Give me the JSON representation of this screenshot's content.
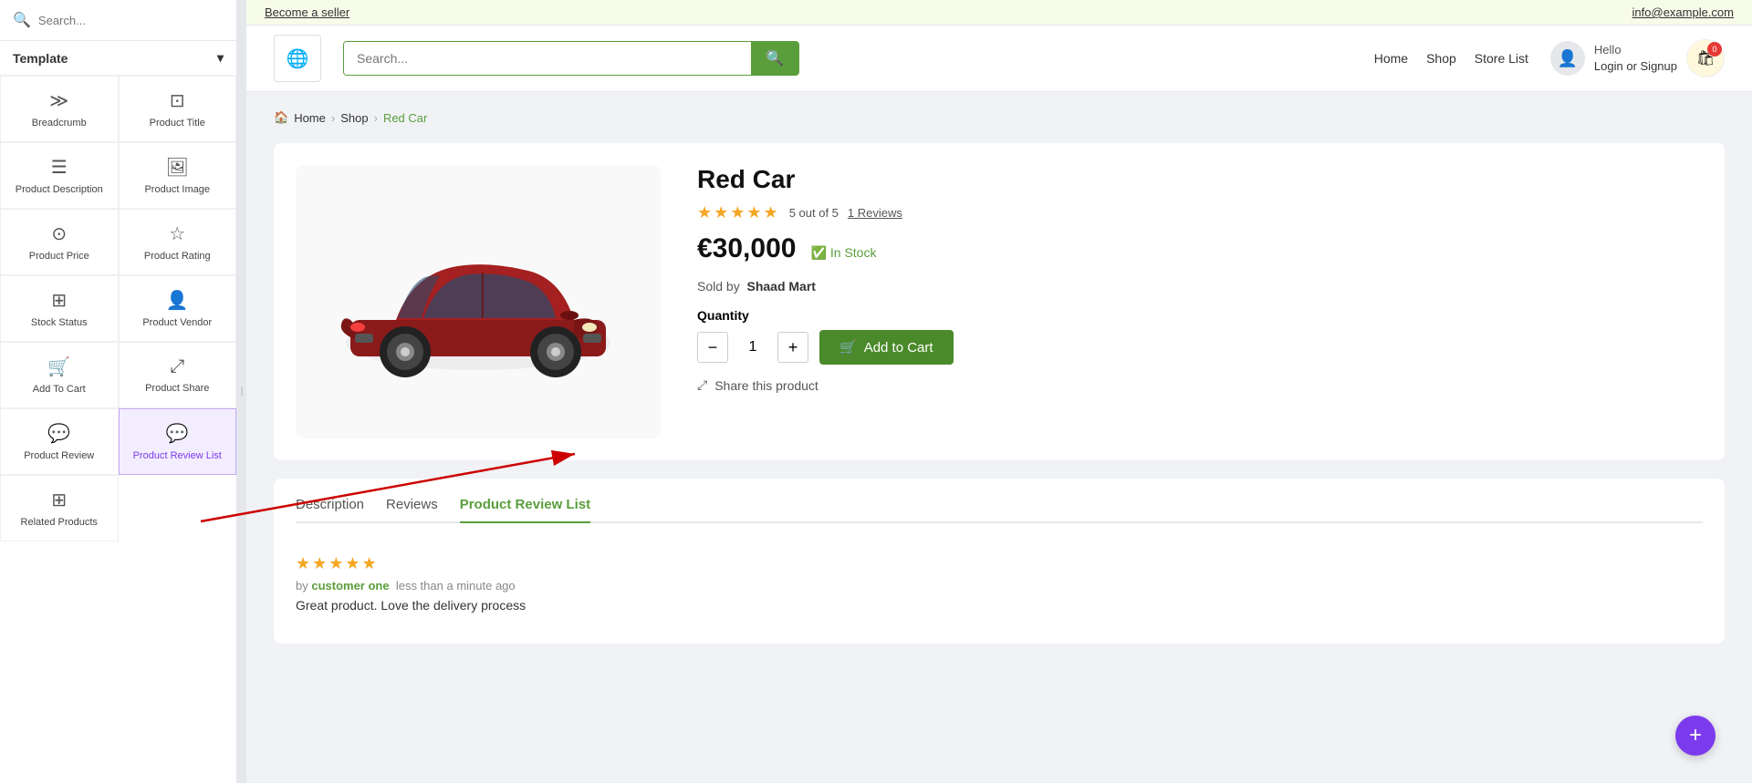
{
  "topbar": {
    "become_seller": "Become a seller",
    "contact_email": "info@example.com"
  },
  "navbar": {
    "logo_icon": "🌐",
    "search_placeholder": "Search...",
    "links": [
      "Home",
      "Shop",
      "Store List"
    ],
    "user_greeting": "Hello",
    "user_action": "Login or Signup",
    "cart_count": "0"
  },
  "breadcrumb": {
    "home": "Home",
    "shop": "Shop",
    "current": "Red Car"
  },
  "product": {
    "title": "Red Car",
    "rating_stars": "★★★★★",
    "rating_value": "5 out of 5",
    "reviews_count": "1 Reviews",
    "price": "€30,000",
    "in_stock": "In Stock",
    "sold_by_label": "Sold by",
    "vendor": "Shaad Mart",
    "quantity_label": "Quantity",
    "quantity_value": "1",
    "quantity_minus": "−",
    "quantity_plus": "+",
    "add_to_cart": "Add to Cart",
    "share_label": "Share this product"
  },
  "tabs": [
    {
      "label": "Description",
      "active": false
    },
    {
      "label": "Reviews",
      "active": false
    },
    {
      "label": "Product Review List",
      "active": true
    }
  ],
  "review": {
    "stars": "★★★★★",
    "author": "customer one",
    "time": "less than a minute ago",
    "text": "Great product. Love the delivery process"
  },
  "sidebar": {
    "search_placeholder": "Search...",
    "section_label": "Template",
    "items": [
      {
        "id": "breadcrumb",
        "label": "Breadcrumb",
        "icon": "≫",
        "active": false
      },
      {
        "id": "product-title",
        "label": "Product Title",
        "icon": "⊡",
        "active": false
      },
      {
        "id": "product-description",
        "label": "Product Description",
        "icon": "☰",
        "active": false
      },
      {
        "id": "product-image",
        "label": "Product Image",
        "icon": "🖼",
        "active": false
      },
      {
        "id": "product-price",
        "label": "Product Price",
        "icon": "⊙",
        "active": false
      },
      {
        "id": "product-rating",
        "label": "Product Rating",
        "icon": "☆",
        "active": false
      },
      {
        "id": "stock-status",
        "label": "Stock Status",
        "icon": "⊞",
        "active": false
      },
      {
        "id": "product-vendor",
        "label": "Product Vendor",
        "icon": "👤",
        "active": false
      },
      {
        "id": "add-to-cart",
        "label": "Add To Cart",
        "icon": "🛒",
        "active": false
      },
      {
        "id": "product-share",
        "label": "Product Share",
        "icon": "⤢",
        "active": false
      },
      {
        "id": "product-review",
        "label": "Product Review",
        "icon": "💬",
        "active": false
      },
      {
        "id": "product-review-list",
        "label": "Product Review List",
        "icon": "💬",
        "active": true
      },
      {
        "id": "related-products",
        "label": "Related Products",
        "icon": "⊞",
        "active": false
      }
    ]
  },
  "fab": "+"
}
